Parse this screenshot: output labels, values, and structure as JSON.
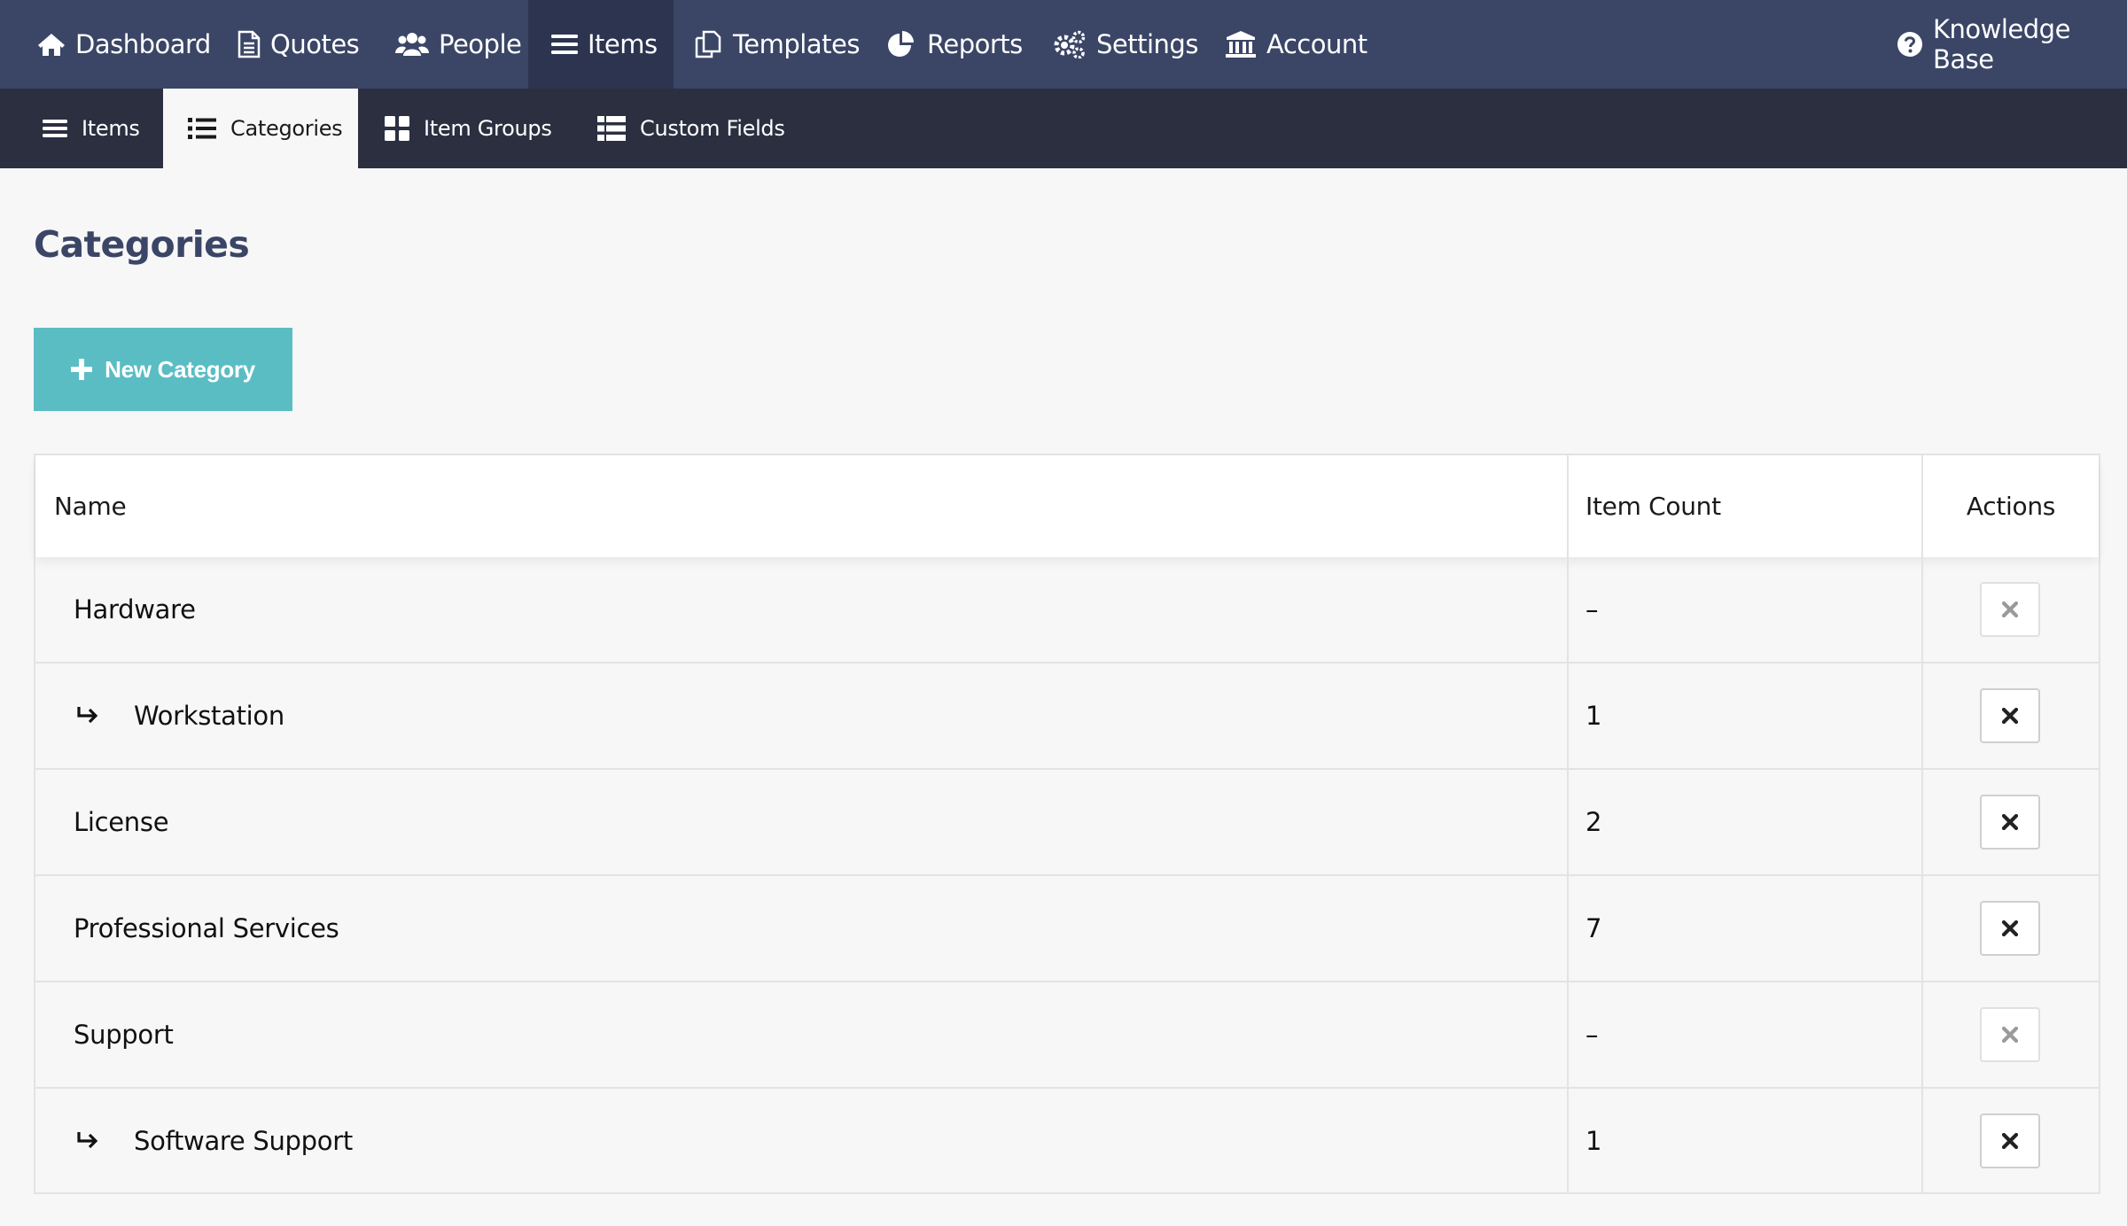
{
  "top_nav": [
    {
      "label": "Dashboard",
      "icon": "home-icon"
    },
    {
      "label": "Quotes",
      "icon": "document-icon"
    },
    {
      "label": "People",
      "icon": "users-icon"
    },
    {
      "label": "Items",
      "icon": "list-icon",
      "active": true
    },
    {
      "label": "Templates",
      "icon": "copy-icon"
    },
    {
      "label": "Reports",
      "icon": "pie-chart-icon"
    },
    {
      "label": "Settings",
      "icon": "gears-icon"
    },
    {
      "label": "Account",
      "icon": "bank-icon"
    },
    {
      "label": "Knowledge Base",
      "icon": "help-circle-icon"
    }
  ],
  "sub_nav": [
    {
      "label": "Items",
      "icon": "list-icon"
    },
    {
      "label": "Categories",
      "icon": "list-bullets-icon",
      "active": true
    },
    {
      "label": "Item Groups",
      "icon": "grid-icon"
    },
    {
      "label": "Custom Fields",
      "icon": "table-list-icon"
    }
  ],
  "page": {
    "title": "Categories",
    "new_button_label": "New Category"
  },
  "table": {
    "headers": {
      "name": "Name",
      "item_count": "Item Count",
      "actions": "Actions"
    },
    "rows": [
      {
        "name": "Hardware",
        "item_count": "–",
        "child": false,
        "delete_enabled": false
      },
      {
        "name": "Workstation",
        "item_count": "1",
        "child": true,
        "delete_enabled": true
      },
      {
        "name": "License",
        "item_count": "2",
        "child": false,
        "delete_enabled": true
      },
      {
        "name": "Professional Services",
        "item_count": "7",
        "child": false,
        "delete_enabled": true
      },
      {
        "name": "Support",
        "item_count": "–",
        "child": false,
        "delete_enabled": false
      },
      {
        "name": "Software Support",
        "item_count": "1",
        "child": true,
        "delete_enabled": true
      }
    ]
  },
  "colors": {
    "top_nav_bg": "#3b4566",
    "top_nav_active_bg": "#2c3450",
    "sub_nav_bg": "#2b2f40",
    "page_bg": "#f7f7f7",
    "title_color": "#3b4566",
    "primary_button": "#5bbdc4"
  }
}
